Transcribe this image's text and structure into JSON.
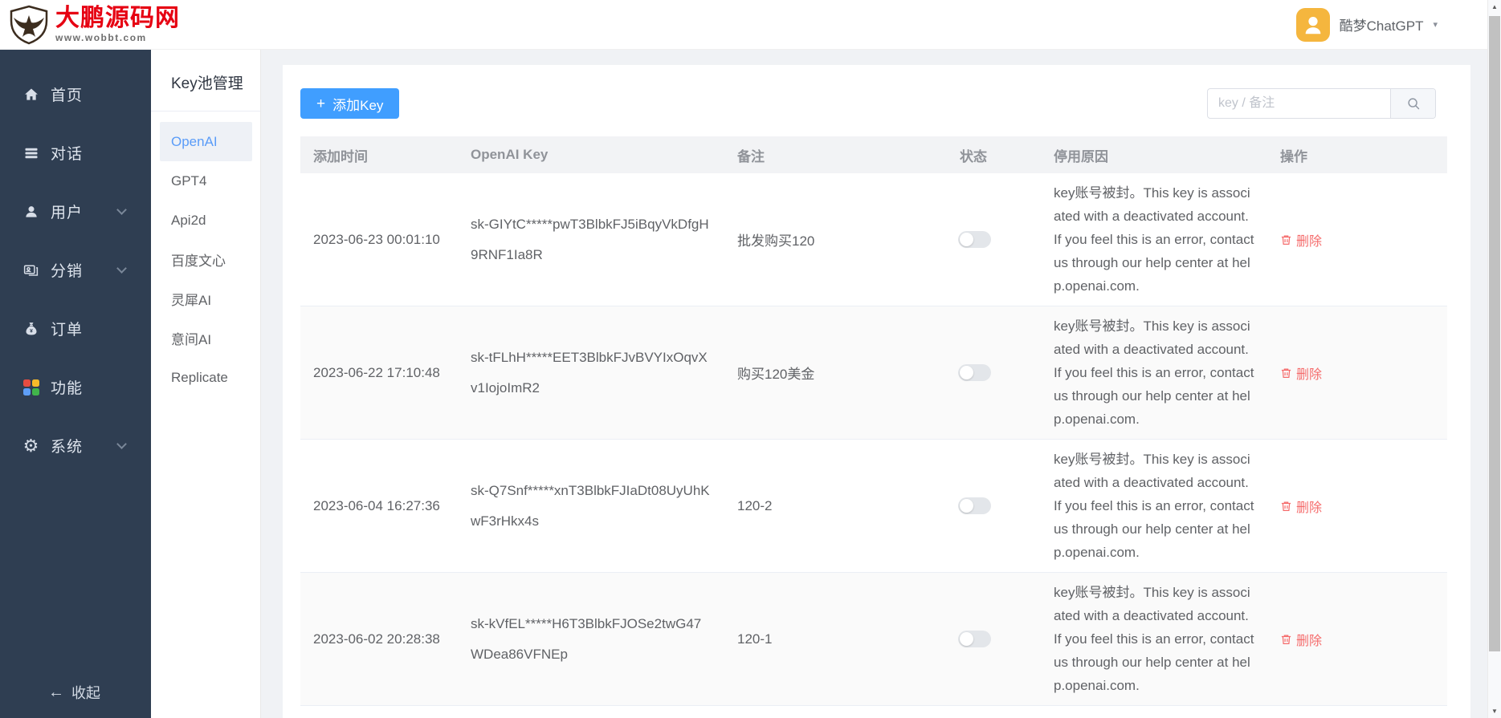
{
  "navbar": {
    "logo_title": "大鹏源码网",
    "logo_subtitle": "www.wobbt.com",
    "user_name": "酷梦ChatGPT"
  },
  "sidebar": {
    "items": [
      {
        "label": "首页",
        "icon": "home-icon",
        "expandable": false
      },
      {
        "label": "对话",
        "icon": "chat-list-icon",
        "expandable": false
      },
      {
        "label": "用户",
        "icon": "user-icon",
        "expandable": true
      },
      {
        "label": "分销",
        "icon": "distribution-card-icon",
        "expandable": true
      },
      {
        "label": "订单",
        "icon": "moneybag-icon",
        "expandable": false
      },
      {
        "label": "功能",
        "icon": "colored-grid-icon",
        "expandable": false
      },
      {
        "label": "系统",
        "icon": "gear-icon",
        "expandable": true
      }
    ],
    "collapse_label": "收起"
  },
  "submenu": {
    "title": "Key池管理",
    "items": [
      {
        "label": "OpenAI",
        "active": true
      },
      {
        "label": "GPT4",
        "active": false
      },
      {
        "label": "Api2d",
        "active": false
      },
      {
        "label": "百度文心",
        "active": false
      },
      {
        "label": "灵犀AI",
        "active": false
      },
      {
        "label": "意间AI",
        "active": false
      },
      {
        "label": "Replicate",
        "active": false
      }
    ]
  },
  "toolbar": {
    "add_label": "添加Key",
    "search_placeholder": "key / 备注"
  },
  "table": {
    "columns": [
      "添加时间",
      "OpenAI Key",
      "备注",
      "状态",
      "停用原因",
      "操作"
    ],
    "delete_label": "删除",
    "rows": [
      {
        "time": "2023-06-23 00:01:10",
        "key": "sk-GIYtC*****pwT3BlbkFJ5iBqyVkDfgH9RNF1Ia8R",
        "note": "批发购买120",
        "enabled": false,
        "reason": "key账号被封。This key is associated with a deactivated account. If you feel this is an error, contact us through our help center at help.openai.com."
      },
      {
        "time": "2023-06-22 17:10:48",
        "key": "sk-tFLhH*****EET3BlbkFJvBVYIxOqvXv1IojoImR2",
        "note": "购买120美金",
        "enabled": false,
        "reason": "key账号被封。This key is associated with a deactivated account. If you feel this is an error, contact us through our help center at help.openai.com."
      },
      {
        "time": "2023-06-04 16:27:36",
        "key": "sk-Q7Snf*****xnT3BlbkFJIaDt08UyUhKwF3rHkx4s",
        "note": "120-2",
        "enabled": false,
        "reason": "key账号被封。This key is associated with a deactivated account. If you feel this is an error, contact us through our help center at help.openai.com."
      },
      {
        "time": "2023-06-02 20:28:38",
        "key": "sk-kVfEL*****H6T3BlbkFJOSe2twG47WDea86VFNEp",
        "note": "120-1",
        "enabled": false,
        "reason": "key账号被封。This key is associated with a deactivated account. If you feel this is an error, contact us through our help center at help.openai.com."
      }
    ]
  },
  "icons": {
    "plus": "+",
    "caret_down": "▾",
    "back_arrow": "←",
    "gear": "⚙",
    "scroll_up": "▲",
    "scroll_down": "▼"
  },
  "colors": {
    "accent_blue": "#409eff",
    "active_link_blue": "#5a9cf8",
    "danger_red": "#f56c6c",
    "logo_red": "#e60012",
    "sidebar_bg": "#2f3e52",
    "avatar_yellow": "#f5b63e",
    "header_bg": "#f2f3f5"
  }
}
